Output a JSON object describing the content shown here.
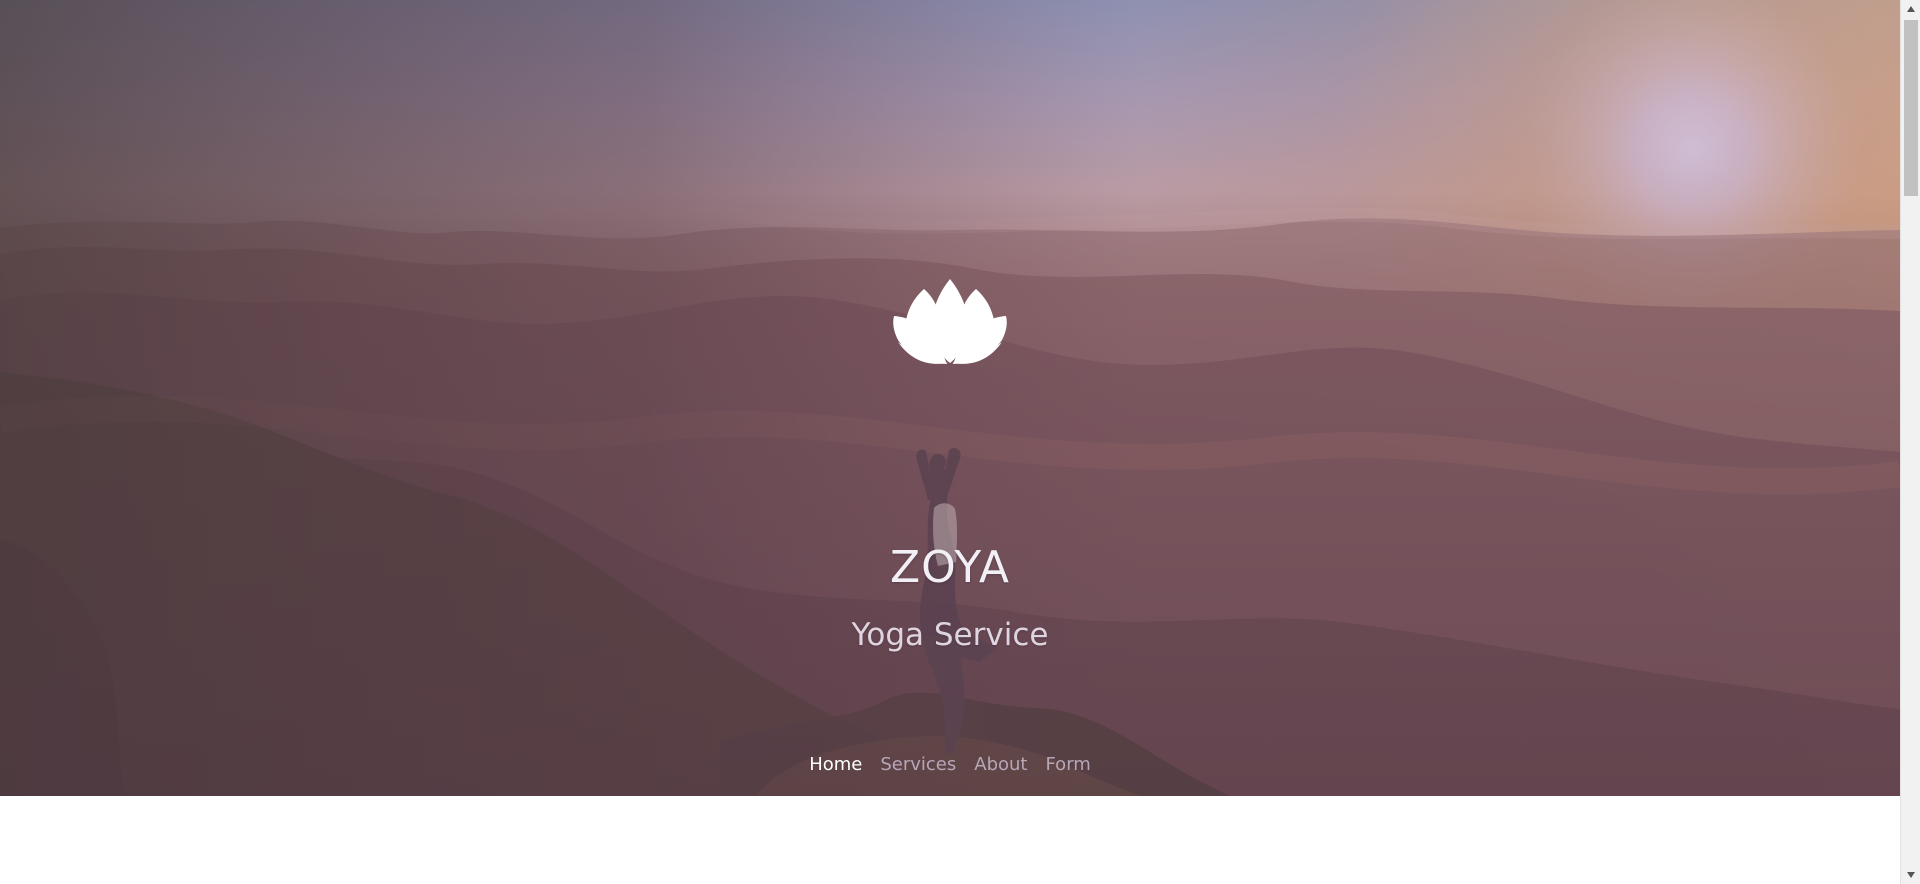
{
  "brand": {
    "title": "ZOYA",
    "subtitle": "Yoga Service",
    "logo_icon": "lotus-icon"
  },
  "navigation": {
    "items": [
      {
        "label": "Home",
        "active": true
      },
      {
        "label": "Services",
        "active": false
      },
      {
        "label": "About",
        "active": false
      },
      {
        "label": "Form",
        "active": false
      }
    ]
  },
  "theme": {
    "hero_overlay": "#6f4b5a",
    "nav_active": "#ffffff",
    "nav_inactive": "#b7a6b8",
    "indicator": "#9f86c9"
  },
  "hero_image": {
    "subject": "person practicing tree pose on a mountain overlook at sunrise"
  }
}
